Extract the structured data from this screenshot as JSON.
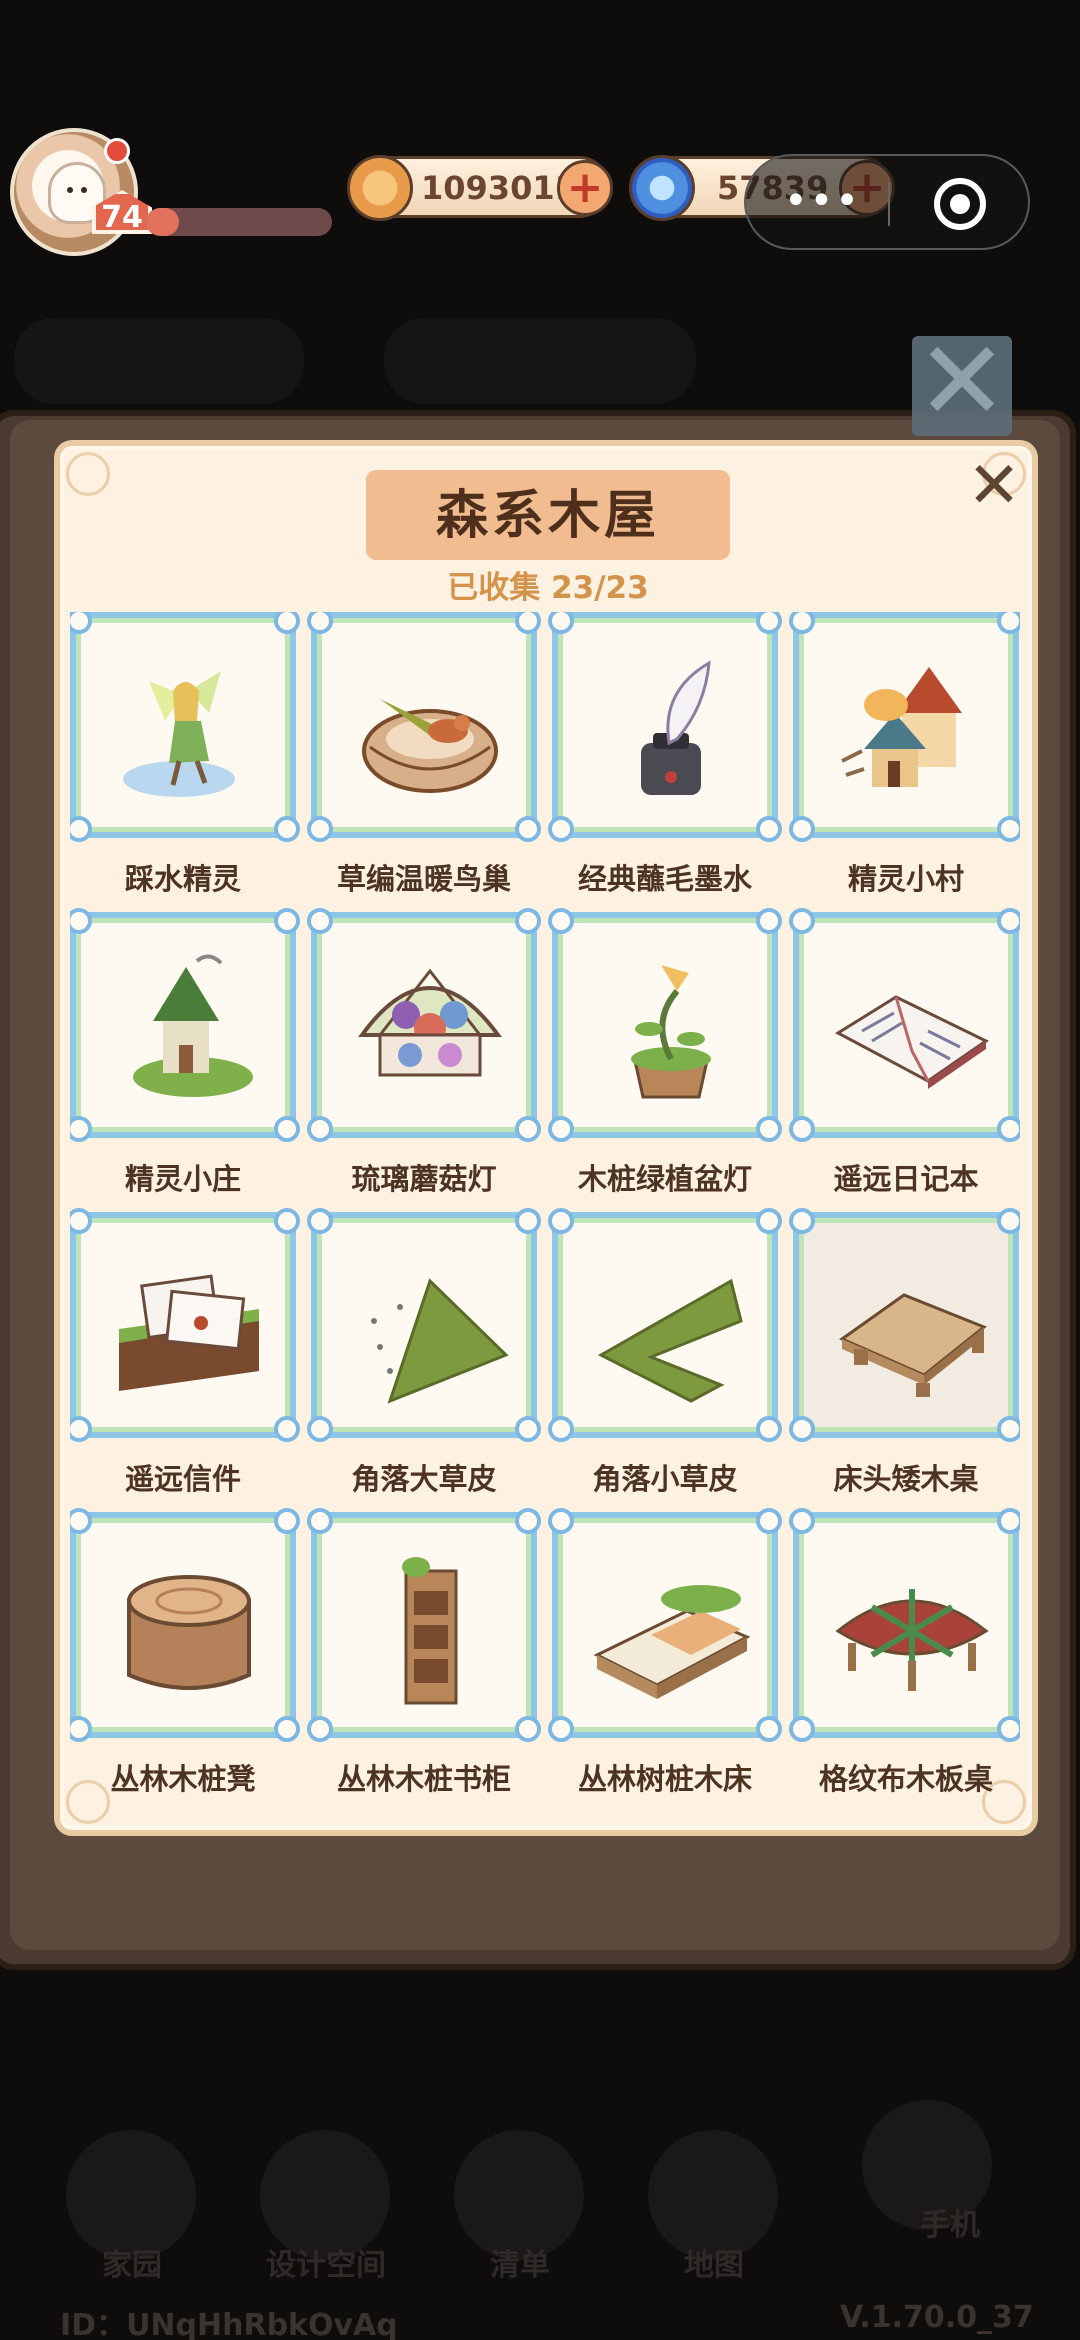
{
  "hud": {
    "level": "74",
    "xp_fraction": 0.18,
    "coins": "1093011",
    "gems": "57839",
    "capsule_more": "•••"
  },
  "panel": {
    "title": "森系木屋",
    "collected": "已收集 23/23",
    "close": "✕"
  },
  "items": [
    {
      "name": "踩水精灵",
      "icon": "fairy-icon"
    },
    {
      "name": "草编温暖鸟巢",
      "icon": "bird-nest-icon"
    },
    {
      "name": "经典蘸毛墨水",
      "icon": "quill-ink-icon"
    },
    {
      "name": "精灵小村",
      "icon": "fairy-village-icon"
    },
    {
      "name": "精灵小庄",
      "icon": "fairy-cottage-icon"
    },
    {
      "name": "琉璃蘑菇灯",
      "icon": "mushroom-lamp-icon"
    },
    {
      "name": "木桩绿植盆灯",
      "icon": "stump-plant-lamp-icon"
    },
    {
      "name": "遥远日记本",
      "icon": "diary-icon"
    },
    {
      "name": "遥远信件",
      "icon": "letters-icon"
    },
    {
      "name": "角落大草皮",
      "icon": "large-grass-icon"
    },
    {
      "name": "角落小草皮",
      "icon": "small-grass-icon"
    },
    {
      "name": "床头矮木桌",
      "icon": "low-table-icon"
    },
    {
      "name": "丛林木桩凳",
      "icon": "stump-stool-icon"
    },
    {
      "name": "丛林木桩书柜",
      "icon": "stump-bookcase-icon"
    },
    {
      "name": "丛林树桩木床",
      "icon": "stump-bed-icon"
    },
    {
      "name": "格纹布木板桌",
      "icon": "plaid-table-icon"
    }
  ],
  "nav": [
    "家园",
    "设计空间",
    "清单",
    "地图",
    "手机"
  ],
  "footer": {
    "id": "ID：UNqHhRbkOvAq",
    "version": "V.1.70.0_37"
  },
  "colors": {
    "frame_blue": "#8ec6e8",
    "frame_green": "#bfe4b8",
    "title_plate": "#f1bd90",
    "collected_text": "#d3934b"
  }
}
